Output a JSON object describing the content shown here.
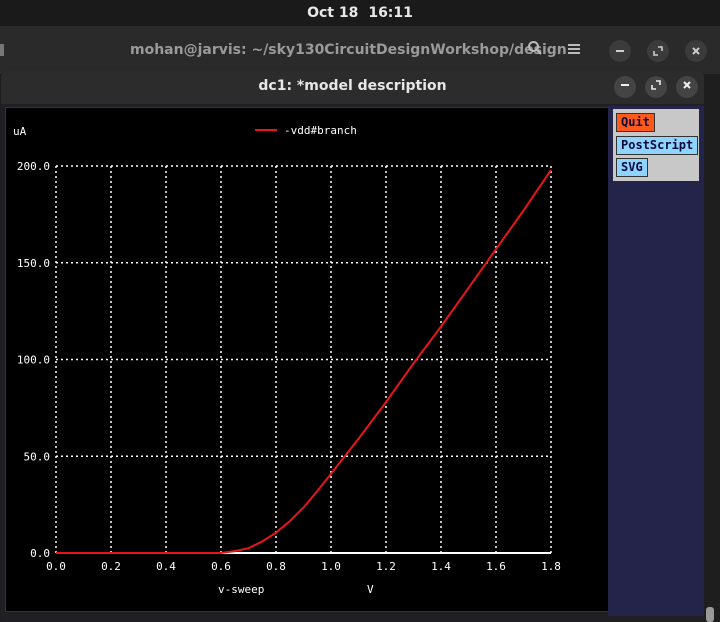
{
  "topbar": {
    "date": "Oct 18",
    "time": "16:11"
  },
  "bg_terminal": {
    "title": "mohan@jarvis: ~/sky130CircuitDesignWorkshop/design"
  },
  "window": {
    "title": "dc1: *model description"
  },
  "controls": {
    "quit": "Quit",
    "postscript": "PostScript",
    "svg": "SVG"
  },
  "colors": {
    "trace": "#e8151b",
    "background": "#000000",
    "grid": "#ffffff",
    "quit": "#ff5a1c",
    "button": "#8fd3ff"
  },
  "chart_data": {
    "type": "line",
    "ylabel_unit": "uA",
    "xlabel": "v-sweep",
    "xunit": "V",
    "xlim": [
      0.0,
      1.8
    ],
    "ylim": [
      0.0,
      200.0
    ],
    "xticks": [
      "0.0",
      "0.2",
      "0.4",
      "0.6",
      "0.8",
      "1.0",
      "1.2",
      "1.4",
      "1.6",
      "1.8"
    ],
    "yticks": [
      "0.0",
      "50.0",
      "100.0",
      "150.0",
      "200.0"
    ],
    "grid": true,
    "legend_position": "top-center",
    "series": [
      {
        "name": "-vdd#branch",
        "x": [
          0.0,
          0.1,
          0.2,
          0.3,
          0.4,
          0.5,
          0.6,
          0.65,
          0.7,
          0.75,
          0.8,
          0.85,
          0.9,
          0.95,
          1.0,
          1.1,
          1.2,
          1.3,
          1.4,
          1.5,
          1.6,
          1.7,
          1.8
        ],
        "y": [
          0,
          0,
          0,
          0,
          0,
          0,
          0,
          1,
          2.5,
          6,
          10.5,
          16.5,
          23.5,
          32,
          41,
          59,
          78,
          98,
          117,
          137,
          157,
          177,
          198
        ]
      }
    ]
  }
}
